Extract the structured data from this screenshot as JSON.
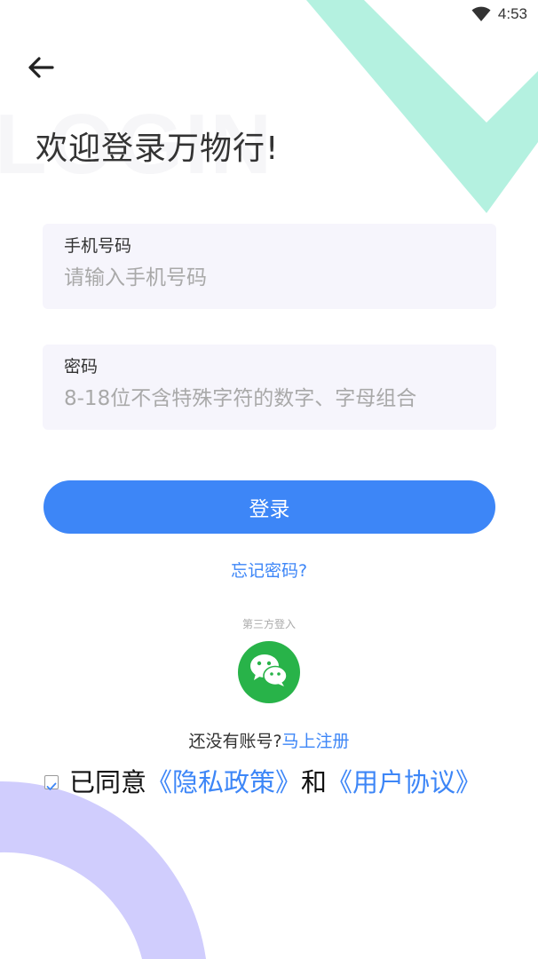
{
  "status_bar": {
    "time": "4:53",
    "wifi_icon": "wifi-icon"
  },
  "watermark": "LOGIN",
  "header": {
    "back_icon": "arrow-left-icon",
    "title": "欢迎登录万物行!"
  },
  "form": {
    "phone": {
      "label": "手机号码",
      "placeholder": "请输入手机号码",
      "value": ""
    },
    "password": {
      "label": "密码",
      "placeholder": "8-18位不含特殊字符的数字、字母组合",
      "value": ""
    },
    "login_label": "登录",
    "forgot_label": "忘记密码?"
  },
  "third_party": {
    "label": "第三方登入",
    "wechat_icon": "wechat-icon"
  },
  "register": {
    "prompt": "还没有账号?",
    "link": "马上注册"
  },
  "agreement": {
    "checked": true,
    "prefix": "已同意",
    "privacy": "《隐私政策》",
    "and": "和",
    "user_agreement": "《用户协议》"
  },
  "colors": {
    "accent": "#3d86f7",
    "wechat": "#28b349",
    "mint_deco": "#b4f1e0",
    "lavender_deco": "#d0cdfd",
    "field_bg": "#f6f5fc"
  }
}
